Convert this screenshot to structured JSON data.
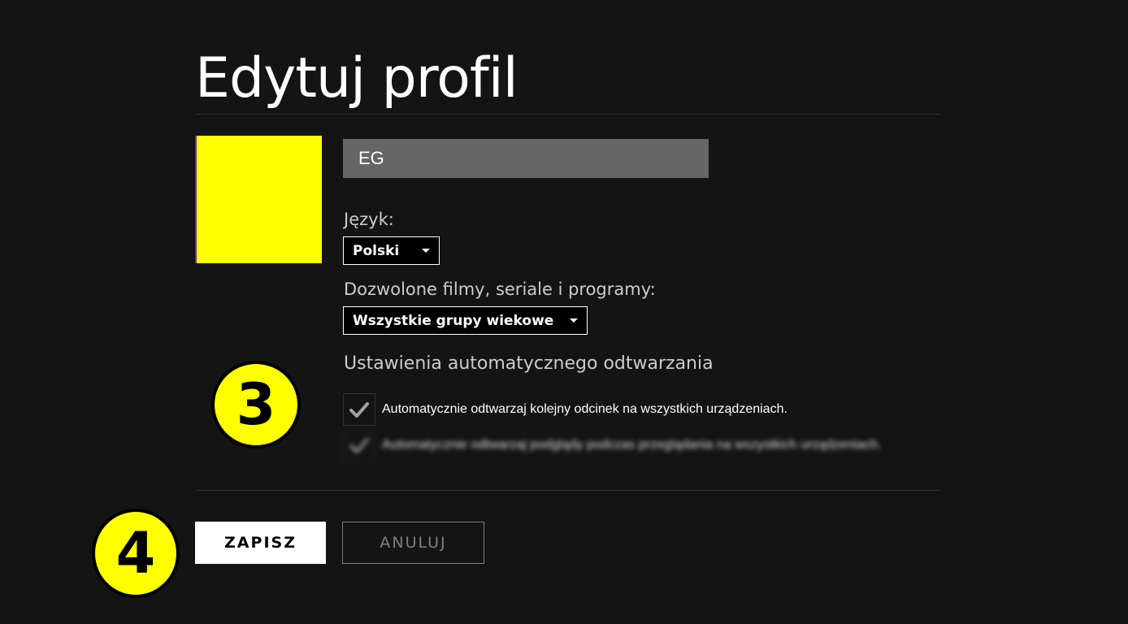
{
  "page": {
    "title": "Edytuj profil"
  },
  "profile": {
    "name_value": "EG",
    "avatar_color": "#ffff00"
  },
  "language": {
    "label": "Język:",
    "selected": "Polski"
  },
  "maturity": {
    "label": "Dozwolone filmy, seriale i programy:",
    "selected": "Wszystkie grupy wiekowe"
  },
  "autoplay": {
    "heading": "Ustawienia automatycznego odtwarzania",
    "options": [
      {
        "label": "Automatycznie odtwarzaj kolejny odcinek na wszystkich urządzeniach.",
        "checked": true
      },
      {
        "label": "Automatycznie odtwarzaj podglądy podczas przeglądania na wszystkich urządzeniach.",
        "checked": true
      }
    ]
  },
  "annotations": {
    "step_three": "3",
    "step_four": "4",
    "badge_color": "#ffff00"
  },
  "actions": {
    "save_label": "ZAPISZ",
    "cancel_label": "ANULUJ"
  }
}
